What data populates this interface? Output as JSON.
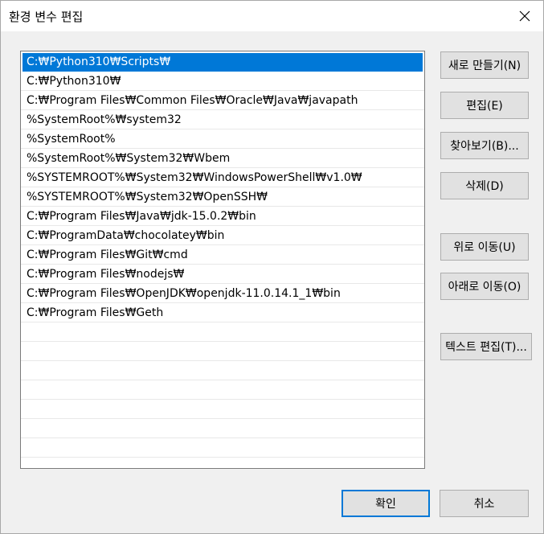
{
  "window": {
    "title": "환경 변수 편집",
    "close_icon": "close-icon"
  },
  "path_list": {
    "selected_index": 0,
    "items": [
      "C:₩Python310₩Scripts₩",
      "C:₩Python310₩",
      "C:₩Program Files₩Common Files₩Oracle₩Java₩javapath",
      "%SystemRoot%₩system32",
      "%SystemRoot%",
      "%SystemRoot%₩System32₩Wbem",
      "%SYSTEMROOT%₩System32₩WindowsPowerShell₩v1.0₩",
      "%SYSTEMROOT%₩System32₩OpenSSH₩",
      "C:₩Program Files₩Java₩jdk-15.0.2₩bin",
      "C:₩ProgramData₩chocolatey₩bin",
      "C:₩Program Files₩Git₩cmd",
      "C:₩Program Files₩nodejs₩",
      "C:₩Program Files₩OpenJDK₩openjdk-11.0.14.1_1₩bin",
      "C:₩Program Files₩Geth",
      "",
      "",
      "",
      "",
      "",
      "",
      "",
      ""
    ]
  },
  "buttons": {
    "new": "새로 만들기(N)",
    "edit": "편집(E)",
    "browse": "찾아보기(B)...",
    "delete": "삭제(D)",
    "move_up": "위로 이동(U)",
    "move_down": "아래로 이동(O)",
    "edit_text": "텍스트 편집(T)...",
    "ok": "확인",
    "cancel": "취소"
  },
  "colors": {
    "selection": "#0078d7",
    "dialog_background": "#f0f0f0",
    "button_face": "#e1e1e1"
  }
}
